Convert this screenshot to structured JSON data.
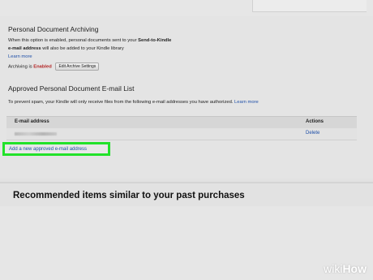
{
  "archiving": {
    "title": "Personal Document Archiving",
    "desc_part1": "When this option is enabled, personal documents sent to your ",
    "desc_bold1": "Send-to-Kindle",
    "desc_bold2": "e-mail address",
    "desc_part2": " will also be added to your Kindle library",
    "learn_more": "Learn more",
    "status_label": "Archiving is ",
    "status_value": "Enabled",
    "edit_button": "Edit Archive Settings"
  },
  "approved": {
    "title": "Approved Personal Document E-mail List",
    "desc": "To prevent spam, your Kindle will only receive files from the following e-mail addresses you have authorized.",
    "learn_more": "Learn more",
    "col_email": "E-mail address",
    "col_actions": "Actions",
    "row_action": "Delete",
    "add_link": "Add a new approved e-mail address"
  },
  "recommended": {
    "title": "Recommended items similar to your past purchases"
  },
  "watermark": {
    "wiki": "wiki",
    "how": "How"
  },
  "colors": {
    "highlight": "#22e22a",
    "link": "#1f4fa8",
    "enabled": "#b22222"
  }
}
